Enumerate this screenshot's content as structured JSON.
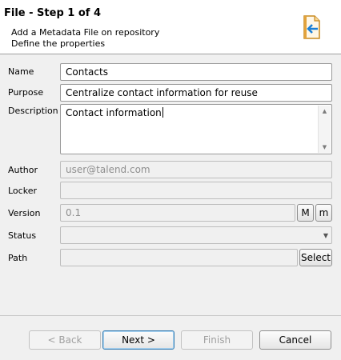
{
  "wizard": {
    "title": "File - Step 1 of 4",
    "description_line1": "Add a Metadata File on repository",
    "description_line2": "Define the properties"
  },
  "form": {
    "name": {
      "label": "Name",
      "value": "Contacts"
    },
    "purpose": {
      "label": "Purpose",
      "value": "Centralize contact information for reuse"
    },
    "description": {
      "label": "Description",
      "value": "Contact information"
    },
    "author": {
      "label": "Author",
      "value": "user@talend.com"
    },
    "locker": {
      "label": "Locker",
      "value": ""
    },
    "version": {
      "label": "Version",
      "value": "0.1",
      "major_button": "M",
      "minor_button": "m"
    },
    "status": {
      "label": "Status",
      "value": ""
    },
    "path": {
      "label": "Path",
      "value": "",
      "select_button": "Select"
    }
  },
  "buttons": {
    "back": "< Back",
    "next": "Next >",
    "finish": "Finish",
    "cancel": "Cancel"
  },
  "colors": {
    "accent_blue": "#3c7fb1",
    "icon_orange": "#e2a23a"
  }
}
